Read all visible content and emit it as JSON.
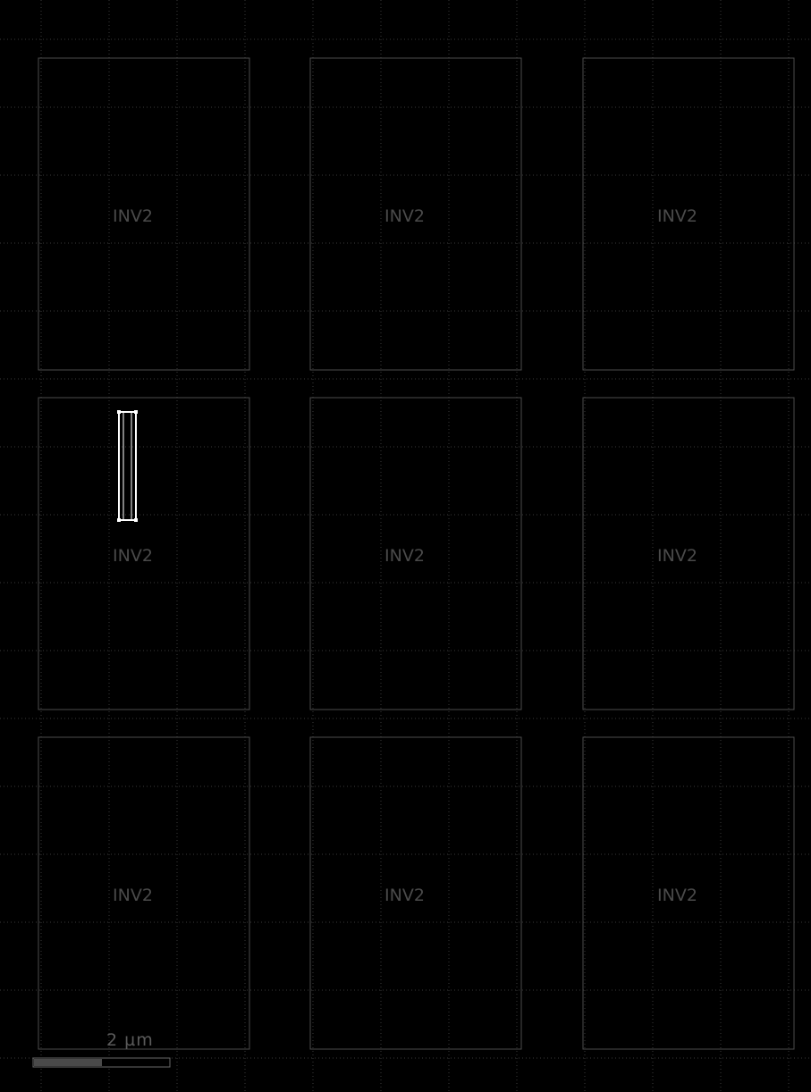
{
  "canvas": {
    "background_color": "#000000",
    "grid_color": "#3a3a3a",
    "grid_style": "dotted"
  },
  "cells": [
    {
      "label": "INV2"
    },
    {
      "label": "INV2"
    },
    {
      "label": "INV2"
    },
    {
      "label": "INV2"
    },
    {
      "label": "INV2"
    },
    {
      "label": "INV2"
    },
    {
      "label": "INV2"
    },
    {
      "label": "INV2"
    },
    {
      "label": "INV2"
    }
  ],
  "cell_color": "#4d4d4d",
  "selection": {
    "cell": "INV2",
    "color": "#ffffff"
  },
  "scale_bar": {
    "label": "2 µm",
    "fill_fraction": 0.5,
    "fill_color": "#4a4a4a",
    "outline_color": "#6a6a6a"
  }
}
